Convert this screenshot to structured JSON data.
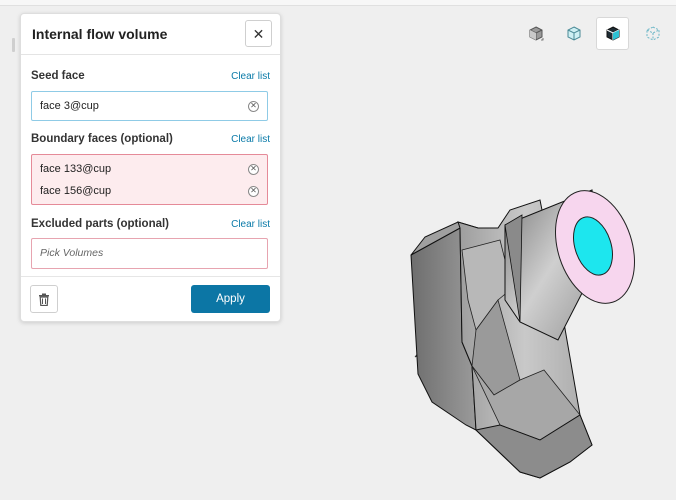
{
  "panel": {
    "title": "Internal flow volume",
    "close_icon": "close-icon"
  },
  "seed_face": {
    "label": "Seed face",
    "clear": "Clear list",
    "items": [
      "face 3@cup"
    ]
  },
  "boundary_faces": {
    "label": "Boundary faces (optional)",
    "clear": "Clear list",
    "items": [
      "face 133@cup",
      "face 156@cup"
    ]
  },
  "excluded_parts": {
    "label": "Excluded parts (optional)",
    "clear": "Clear list",
    "placeholder": "Pick Volumes"
  },
  "footer": {
    "apply": "Apply",
    "delete_icon": "trash-icon"
  },
  "view_toolbar": {
    "buttons": [
      "solid-view-icon",
      "transparent-view-icon",
      "shaded-edges-view-icon",
      "wireframe-view-icon"
    ],
    "active": "shaded-edges-view-icon"
  },
  "colors": {
    "accent": "#0c76a5",
    "selected_face": "#f7d6ee",
    "seed_face": "#1de6ee",
    "model": "#8f8f8f"
  }
}
